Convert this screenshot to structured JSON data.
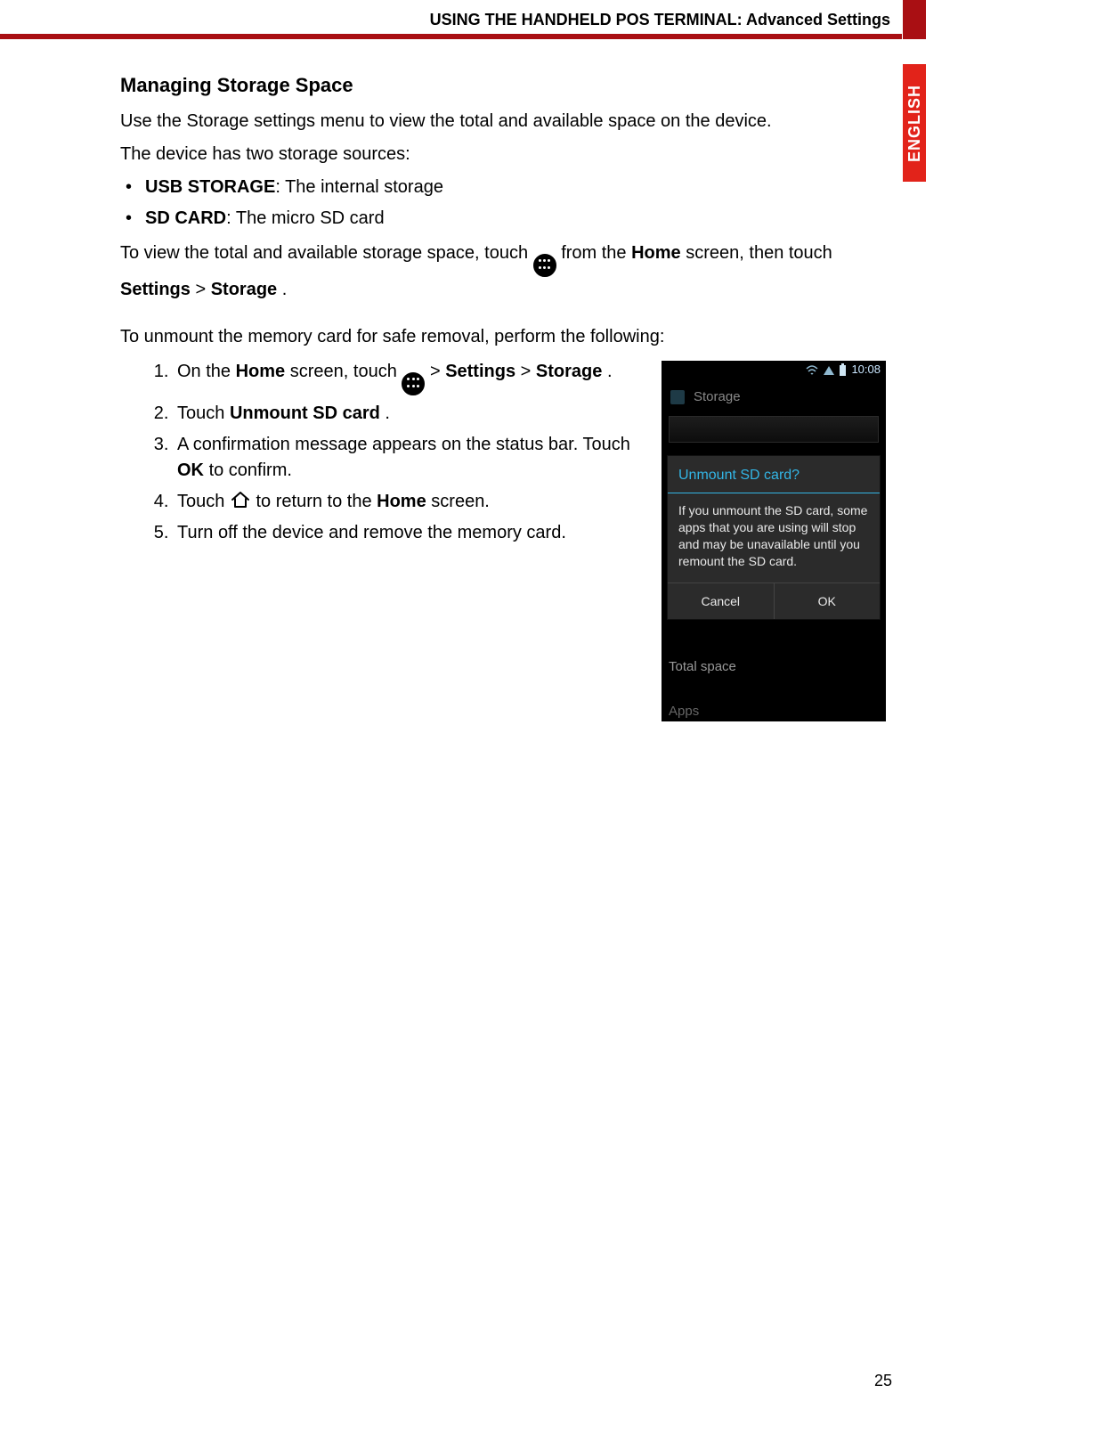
{
  "header": {
    "title": "USING THE HANDHELD POS TERMINAL: Advanced Settings",
    "language_tab": "ENGLISH"
  },
  "section_heading": "Managing Storage Space",
  "intro": {
    "line1": "Use the Storage settings menu to view the total and available space on the device.",
    "line2": "The device has two storage sources:"
  },
  "bullets": [
    {
      "bold": "USB STORAGE",
      "rest": ": The internal storage"
    },
    {
      "bold": "SD CARD",
      "rest": ": The micro SD card"
    }
  ],
  "view_para": {
    "pre": "To view the total and available storage space, touch ",
    "mid": " from the ",
    "home_bold": "Home",
    "mid2": " screen, then touch ",
    "settings_bold": "Settings",
    "gt": " > ",
    "storage_bold": "Storage",
    "end": "."
  },
  "unmount_para": "To unmount the memory card for safe removal, perform the following:",
  "steps": {
    "s1": {
      "pre": "On the ",
      "home_bold": "Home",
      "mid": " screen, touch ",
      "gt": " > ",
      "settings_bold": "Settings",
      "gt2": " > ",
      "storage_bold": "Storage",
      "end": "."
    },
    "s2": {
      "pre": "Touch ",
      "bold": "Unmount SD card",
      "end": "."
    },
    "s3": {
      "pre": "A confirmation message appears on the status bar. Touch ",
      "bold": "OK",
      "end": " to confirm."
    },
    "s4": {
      "pre": "Touch ",
      "post": " to return to the ",
      "bold": "Home",
      "end": " screen."
    },
    "s5": "Turn off the device and remove the memory card."
  },
  "screenshot": {
    "statusbar_time": "10:08",
    "header": "Storage",
    "dialog_title": "Unmount SD card?",
    "dialog_msg": "If you unmount the SD card, some apps that you are using will stop and may be unavailable until you remount the SD card.",
    "btn_cancel": "Cancel",
    "btn_ok": "OK",
    "total_label": "Total space",
    "apps_label": "Apps"
  },
  "page_number": "25"
}
